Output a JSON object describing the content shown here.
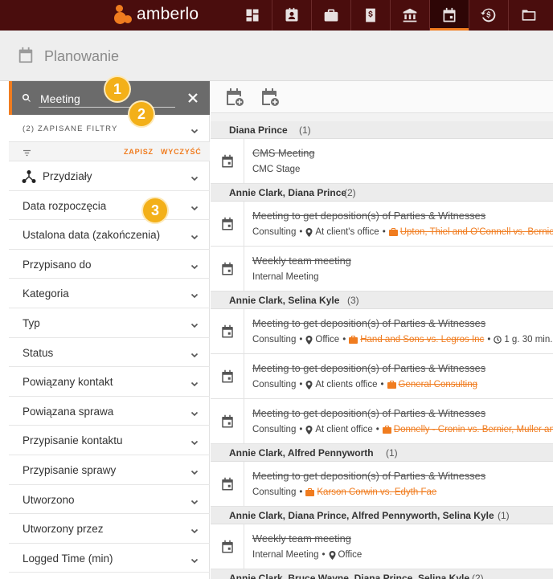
{
  "app": {
    "logo_text": "amberlo",
    "accent": "#f07c1f",
    "topbar_color": "#4a0d0d"
  },
  "topnav": [
    {
      "icon": "dashboard-icon",
      "active": false
    },
    {
      "icon": "contacts-icon",
      "active": false
    },
    {
      "icon": "briefcase-icon",
      "active": false
    },
    {
      "icon": "invoice-icon",
      "active": false
    },
    {
      "icon": "bank-icon",
      "active": false
    },
    {
      "icon": "calendar-icon",
      "active": true
    },
    {
      "icon": "time-billing-icon",
      "active": false
    },
    {
      "icon": "folder-icon",
      "active": false
    }
  ],
  "page": {
    "title": "Planowanie",
    "icon": "calendar-icon"
  },
  "sidebar": {
    "search": {
      "value": "Meeting",
      "placeholder": ""
    },
    "saved_filters_label": "(2) ZAPISANE FILTRY",
    "save_label": "ZAPISZ",
    "clear_label": "WYCZYŚĆ",
    "filters": [
      {
        "label": "Przydziały",
        "icon": "assignments-icon"
      },
      {
        "label": "Data rozpoczęcia"
      },
      {
        "label": "Ustalona data (zakończenia)"
      },
      {
        "label": "Przypisano do"
      },
      {
        "label": "Kategoria"
      },
      {
        "label": "Typ"
      },
      {
        "label": "Status"
      },
      {
        "label": "Powiązany kontakt"
      },
      {
        "label": "Powiązana sprawa"
      },
      {
        "label": "Przypisanie kontaktu"
      },
      {
        "label": "Przypisanie sprawy"
      },
      {
        "label": "Utworzono"
      },
      {
        "label": "Utworzony przez"
      },
      {
        "label": "Logged Time (min)"
      }
    ]
  },
  "callouts": [
    "1",
    "2",
    "3"
  ],
  "toolbar": {
    "buttons": [
      "add-event-icon",
      "add-calendar-event-icon"
    ]
  },
  "groups": [
    {
      "name": "Diana Prince",
      "count": "(1)",
      "events": [
        {
          "title": "CMS Meeting",
          "category": "CMC Stage"
        }
      ]
    },
    {
      "name": "Annie Clark, Diana Prince",
      "count": "(2)",
      "events": [
        {
          "title": "Meeting to get deposition(s) of Parties & Witnesses",
          "category": "Consulting",
          "location": "At client's office",
          "case": "Upton, Thiel and O'Connell vs. Bernier, M"
        },
        {
          "title": "Weekly team meeting",
          "category": "Internal Meeting"
        }
      ]
    },
    {
      "name": "Annie Clark, Selina Kyle",
      "count": "(3)",
      "events": [
        {
          "title": "Meeting to get deposition(s) of Parties & Witnesses",
          "category": "Consulting",
          "location": "Office",
          "case": "Hand and Sons vs. Legros Inc",
          "duration": "1 g. 30 min."
        },
        {
          "title": "Meeting to get deposition(s) of Parties & Witnesses",
          "category": "Consulting",
          "location": "At clients office",
          "case": "General Consulting"
        },
        {
          "title": "Meeting to get deposition(s) of Parties & Witnesses",
          "category": "Consulting",
          "location": "At client office",
          "case": "Donnelly - Cronin vs. Bernier, Muller and H"
        }
      ]
    },
    {
      "name": "Annie Clark, Alfred Pennyworth",
      "count": "(1)",
      "events": [
        {
          "title": "Meeting to get deposition(s) of Parties & Witnesses",
          "category": "Consulting",
          "case": "Karson Corwin vs. Edyth Fae"
        }
      ]
    },
    {
      "name": "Annie Clark, Diana Prince, Alfred Pennyworth, Selina Kyle",
      "count": "(1)",
      "events": [
        {
          "title": "Weekly team meeting",
          "category": "Internal Meeting",
          "location": "Office"
        }
      ]
    },
    {
      "name": "Annie Clark, Bruce Wayne, Diana Prince, Selina Kyle",
      "count": "(2)",
      "events": []
    }
  ]
}
